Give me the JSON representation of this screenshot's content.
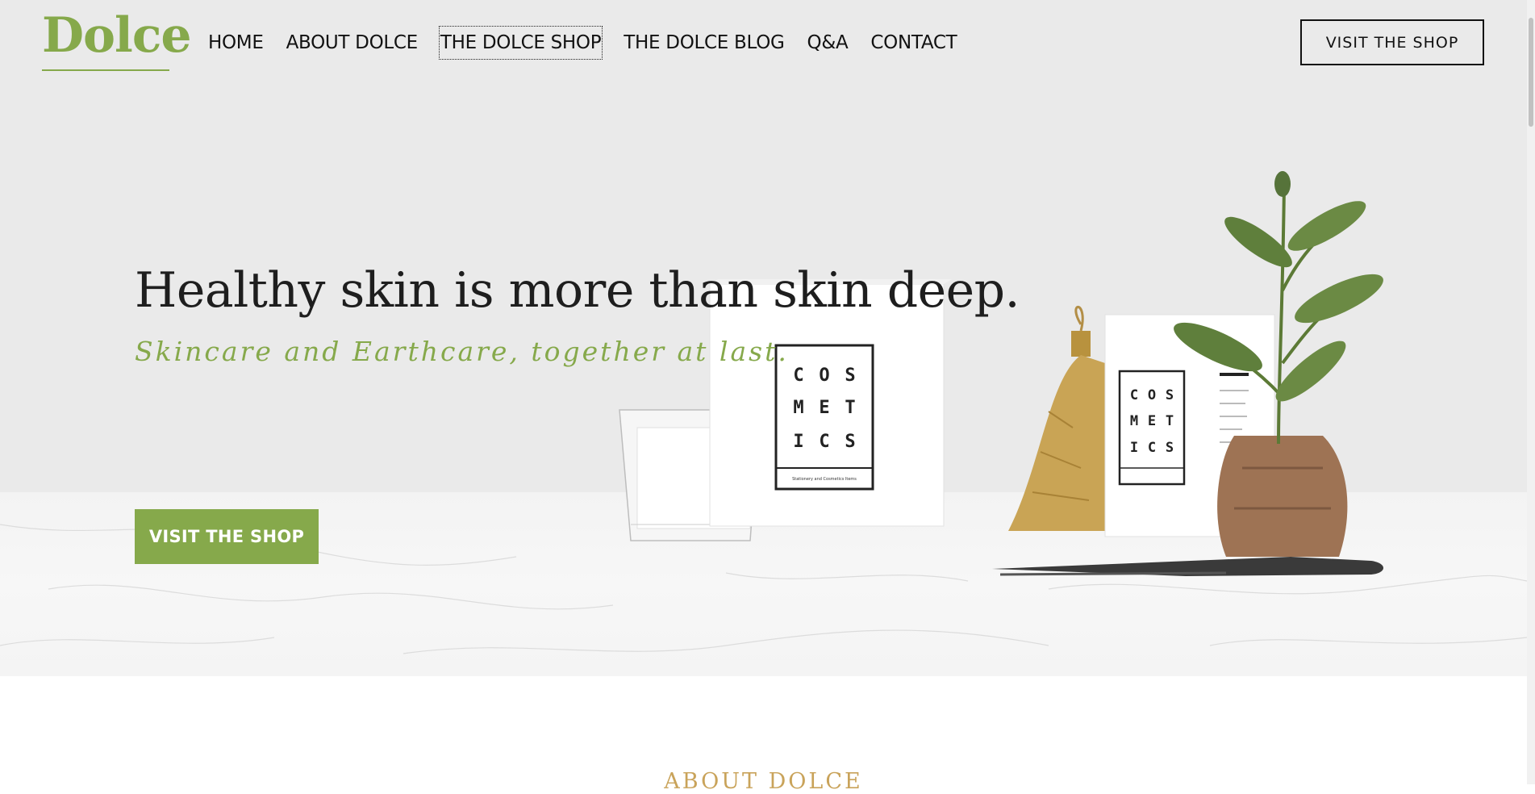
{
  "brand": {
    "logo_text": "Dolce",
    "accent": "#86a94b"
  },
  "nav": {
    "items": [
      {
        "label": "HOME"
      },
      {
        "label": "ABOUT DOLCE"
      },
      {
        "label": "THE DOLCE SHOP"
      },
      {
        "label": "THE DOLCE BLOG"
      },
      {
        "label": "Q&A"
      },
      {
        "label": "CONTACT"
      }
    ],
    "focused_item": "THE DOLCE SHOP"
  },
  "header_cta": {
    "label": "VISIT THE SHOP"
  },
  "hero": {
    "title": "Healthy skin is more than skin deep.",
    "subtitle": "Skincare and Earthcare, together at last.",
    "cta_label": "VISIT THE SHOP",
    "product_box_text": [
      "C",
      "O",
      "S",
      "M",
      "E",
      "T",
      "I",
      "C",
      "S"
    ],
    "product_box_caption": "Stationery and Cosmetics Items"
  },
  "next_section": {
    "heading": "ABOUT DOLCE"
  },
  "colors": {
    "hero_bg": "#eaeaea",
    "heading_gold": "#c9a35a",
    "text_dark": "#1e1e1e"
  }
}
